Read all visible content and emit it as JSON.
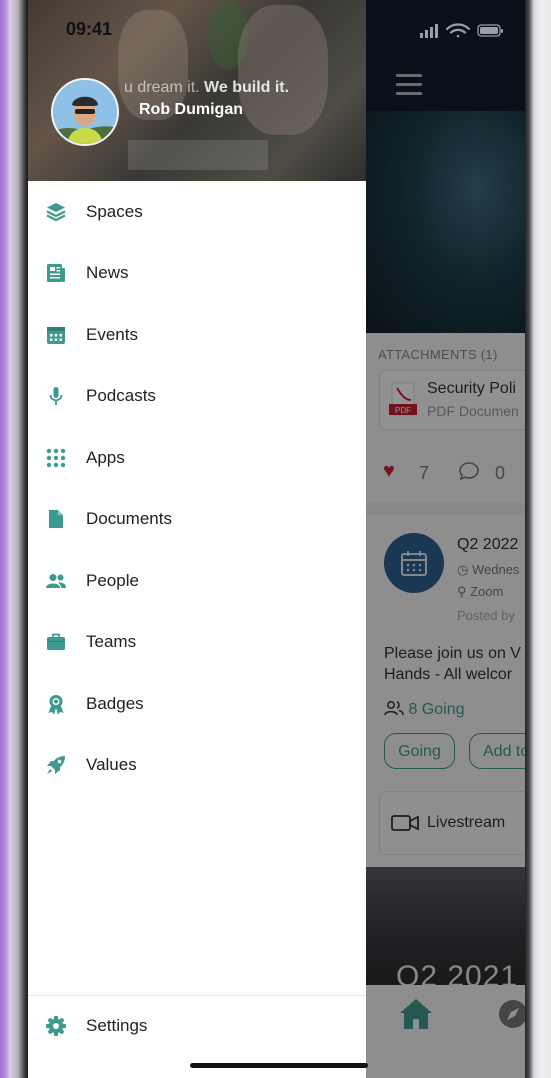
{
  "status_bar": {
    "time": "09:41"
  },
  "drawer": {
    "tagline_light": "u dream it.",
    "tagline_bold": "We build it.",
    "user_name": "Rob Dumigan",
    "nav_items": [
      {
        "label": "Spaces",
        "icon": "layers-icon"
      },
      {
        "label": "News",
        "icon": "newspaper-icon"
      },
      {
        "label": "Events",
        "icon": "calendar-icon"
      },
      {
        "label": "Podcasts",
        "icon": "microphone-icon"
      },
      {
        "label": "Apps",
        "icon": "grid-icon"
      },
      {
        "label": "Documents",
        "icon": "document-icon"
      },
      {
        "label": "People",
        "icon": "people-icon"
      },
      {
        "label": "Teams",
        "icon": "briefcase-icon"
      },
      {
        "label": "Badges",
        "icon": "badge-icon"
      },
      {
        "label": "Values",
        "icon": "rocket-icon"
      }
    ],
    "settings_label": "Settings",
    "accent_color": "#3e9a8f"
  },
  "background_app": {
    "attachments_label": "ATTACHMENTS (1)",
    "attachment_name": "Security Poli",
    "attachment_type": "PDF Documen",
    "like_count": "7",
    "comment_count": "0",
    "event_title": "Q2 2022",
    "event_time": "Wednes",
    "event_location": "Zoom",
    "event_posted": "Posted by",
    "event_description_line1": "Please join us on V",
    "event_description_line2": "Hands - All welcor",
    "going_count": "8 Going",
    "going_button": "Going",
    "add_button": "Add to",
    "livestream_label": "Livestream",
    "hero_text": "Q2 2021"
  }
}
